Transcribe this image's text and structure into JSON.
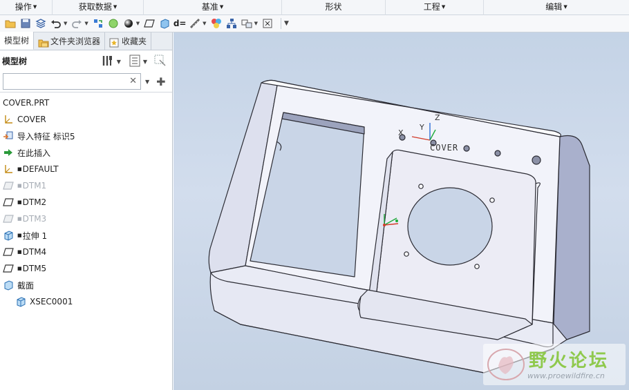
{
  "menubar": {
    "items": [
      {
        "label": "操作"
      },
      {
        "label": "获取数据"
      },
      {
        "label": "基准"
      },
      {
        "label": "形状"
      },
      {
        "label": "工程"
      },
      {
        "label": "编辑"
      }
    ]
  },
  "tabs": {
    "model_tree": "模型树",
    "folder_browser": "文件夹浏览器",
    "favorites": "收藏夹"
  },
  "tree_header": {
    "title": "模型树"
  },
  "filter": {
    "value": "",
    "placeholder": ""
  },
  "tree": {
    "items": [
      {
        "label": "COVER.PRT"
      },
      {
        "label": "COVER"
      },
      {
        "label": "导入特征 标识5"
      },
      {
        "label": "在此插入"
      },
      {
        "label": "DEFAULT"
      },
      {
        "label": "DTM1"
      },
      {
        "label": "DTM2"
      },
      {
        "label": "DTM3"
      },
      {
        "label": "拉伸 1"
      },
      {
        "label": "DTM4"
      },
      {
        "label": "DTM5"
      },
      {
        "label": "截面"
      },
      {
        "label": "XSEC0001"
      }
    ]
  },
  "viewport": {
    "model_label": "COVER",
    "axis_x": "X",
    "axis_y": "Y",
    "axis_z": "Z"
  },
  "watermark": {
    "title": "野火论坛",
    "url": "www.proewildfire.cn"
  },
  "colors": {
    "viewport_bg": "#c8d6e8",
    "model_fill": "#f1f2f9",
    "model_edge": "#2b2b33",
    "datum_x": "#d23a2a",
    "datum_y": "#1faa3a",
    "datum_z": "#2e6fd6",
    "watermark_green": "#8fc94d"
  }
}
